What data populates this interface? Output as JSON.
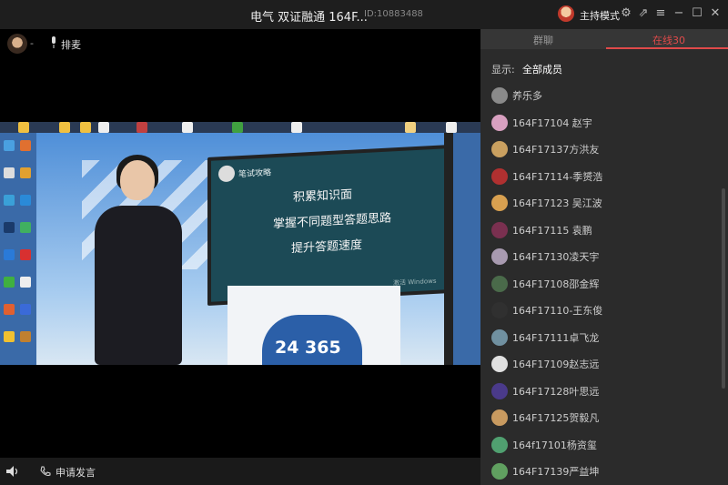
{
  "window": {
    "title": "电气 双证融通 164F...",
    "room_id": "ID:10883488",
    "host_mode_label": "主持模式"
  },
  "stage": {
    "presenter_name": "-",
    "queue_label": "排麦",
    "apply_speak_label": "申请发言"
  },
  "video": {
    "slide_title": "笔试攻略",
    "slide_lines": [
      "积累知识面",
      "掌握不同题型答题思路",
      "提升答题速度"
    ],
    "watermark": "激活 Windows",
    "podium_text": "24 365"
  },
  "panel": {
    "tabs": [
      {
        "label": "群聊",
        "active": false
      },
      {
        "label": "在线30",
        "active": true
      }
    ],
    "filter_label": "显示:",
    "filter_value": "全部成员",
    "members": [
      {
        "name": "养乐多",
        "color": "#8a8a8a"
      },
      {
        "name": "164F17104  赵宇",
        "color": "#d8a0c0"
      },
      {
        "name": "164F17137方洪友",
        "color": "#c9a060"
      },
      {
        "name": "164F17114-季赟浩",
        "color": "#b03030"
      },
      {
        "name": "164F17123  吴江波",
        "color": "#d8a050"
      },
      {
        "name": "164F17115  袁鹏",
        "color": "#7a3050"
      },
      {
        "name": "164F17130凌天宇",
        "color": "#a89ab0"
      },
      {
        "name": "164F17108邵金辉",
        "color": "#4a6a4a"
      },
      {
        "name": "164F17110-王东俊",
        "color": "#303030"
      },
      {
        "name": "164F17111卓飞龙",
        "color": "#7090a0"
      },
      {
        "name": "164F17109赵志远",
        "color": "#e0e0e0"
      },
      {
        "name": "164F17128叶思远",
        "color": "#4a3a8a"
      },
      {
        "name": "164F17125贺毅凡",
        "color": "#c89a60"
      },
      {
        "name": "164f17101杨资玺",
        "color": "#50a070"
      },
      {
        "name": "164F17139严益坤",
        "color": "#60a060"
      }
    ]
  }
}
